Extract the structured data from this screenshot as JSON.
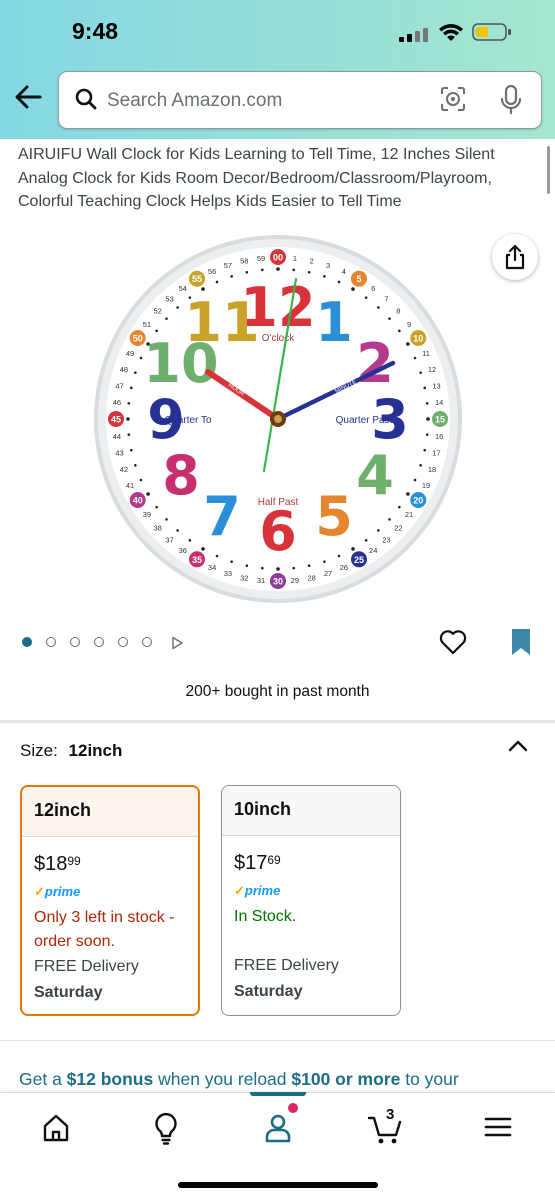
{
  "status_bar": {
    "time": "9:48"
  },
  "search": {
    "placeholder": "Search Amazon.com"
  },
  "product": {
    "title": "AIRUIFU Wall Clock for Kids Learning to Tell Time, 12 Inches Silent Analog Clock for Kids Room Decor/Bedroom/Classroom/Playroom, Colorful Teaching Clock Helps Kids Easier to Tell Time",
    "image_count": 6,
    "active_image": 1,
    "bought_text": "200+ bought in past month"
  },
  "clock_face": {
    "hour_numerals": [
      "12",
      "1",
      "2",
      "3",
      "4",
      "5",
      "6",
      "7",
      "8",
      "9",
      "10",
      "11"
    ],
    "labels": {
      "oclock": "O'clock",
      "quarter_to": "Quarter To",
      "quarter_past": "Quarter Past",
      "half_past": "Half Past"
    },
    "hand_labels": {
      "hour": "HOUR",
      "minute": "MINUTE"
    },
    "minute_numbers": [
      "00",
      "1",
      "2",
      "3",
      "4",
      "5",
      "6",
      "7",
      "8",
      "9",
      "10",
      "11",
      "12",
      "13",
      "14",
      "15",
      "16",
      "17",
      "18",
      "19",
      "20",
      "21",
      "22",
      "23",
      "24",
      "25",
      "26",
      "27",
      "28",
      "29",
      "30",
      "31",
      "32",
      "33",
      "34",
      "35",
      "36",
      "37",
      "38",
      "39",
      "40",
      "41",
      "42",
      "43",
      "44",
      "45",
      "46",
      "47",
      "48",
      "49",
      "50",
      "51",
      "52",
      "53",
      "54",
      "55",
      "56",
      "57",
      "58",
      "59"
    ],
    "colors": {
      "red": "#d8333a",
      "orange": "#e5862e",
      "yellow": "#c9a228",
      "green": "#6fae6d",
      "blue": "#2b8fd8",
      "navy": "#263193",
      "purple": "#8b3b9c",
      "pink": "#c72f6e",
      "magenta": "#b43a8d"
    }
  },
  "size": {
    "label": "Size:",
    "selected": "12inch",
    "options": [
      {
        "name": "12inch",
        "price_whole": "$18",
        "price_frac": "99",
        "prime": "prime",
        "stock": "Only 3 left in stock - order soon.",
        "delivery": "FREE Delivery",
        "delivery_day": "Saturday"
      },
      {
        "name": "10inch",
        "price_whole": "$17",
        "price_frac": "69",
        "prime": "prime",
        "stock": "In Stock.",
        "delivery": "FREE Delivery",
        "delivery_day": "Saturday"
      }
    ]
  },
  "promo": {
    "pre": "Get a ",
    "bonus": "$12 bonus",
    "mid": " when you reload ",
    "amount": "$100 or more",
    "post": " to your"
  },
  "nav": {
    "cart_count": "3",
    "items": [
      "home",
      "inspire",
      "account",
      "cart",
      "menu"
    ]
  },
  "theme": {
    "accent": "#1b6d85",
    "selected_border": "#e77600",
    "low_stock": "#b12704",
    "in_stock": "#007600"
  }
}
